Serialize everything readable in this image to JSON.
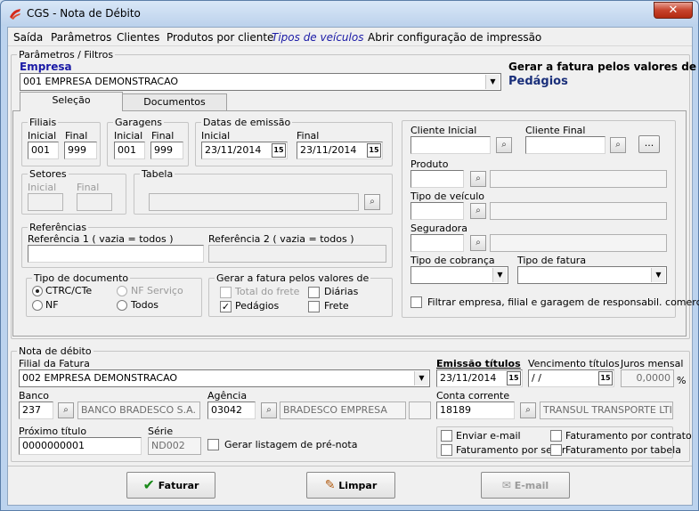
{
  "window": {
    "title": "CGS - Nota de Débito",
    "close": "✕"
  },
  "menu": [
    "Saída",
    "Parâmetros",
    "Clientes",
    "Produtos por cliente",
    "Tipos de veículos",
    "Abrir configuração de impressão"
  ],
  "filters": {
    "group_title": "Parâmetros / Filtros",
    "empresa_label": "Empresa",
    "empresa_value": "001 EMPRESA DEMONSTRACAO",
    "fatura_label": "Gerar a fatura pelos valores de",
    "fatura_value": "Pedágios",
    "tabs": [
      "Seleção",
      "Documentos"
    ],
    "filiais": {
      "title": "Filiais",
      "inicial_label": "Inicial",
      "final_label": "Final",
      "inicial": "001",
      "final": "999"
    },
    "garagens": {
      "title": "Garagens",
      "inicial_label": "Inicial",
      "final_label": "Final",
      "inicial": "001",
      "final": "999"
    },
    "datas": {
      "title": "Datas de emissão",
      "inicial_label": "Inicial",
      "final_label": "Final",
      "inicial": "23/11/2014",
      "final": "23/11/2014"
    },
    "setores": {
      "title": "Setores",
      "inicial_label": "Inicial",
      "final_label": "Final"
    },
    "tabela": {
      "title": "Tabela"
    },
    "referencias": {
      "title": "Referências",
      "ref1_label": "Referência 1 ( vazia = todos )",
      "ref2_label": "Referência 2 ( vazia = todos )"
    },
    "tipo_doc": {
      "title": "Tipo de documento",
      "ctrc": "CTRC/CTe",
      "nfservico": "NF Serviço",
      "nf": "NF",
      "todos": "Todos"
    },
    "gerar": {
      "title": "Gerar a fatura pelos valores de",
      "total_frete": "Total do frete",
      "diarias": "Diárias",
      "pedagios": "Pedágios",
      "frete": "Frete"
    },
    "cliente_inicial": "Cliente Inicial",
    "cliente_final": "Cliente Final",
    "produto": "Produto",
    "tipo_veiculo": "Tipo de veículo",
    "seguradora": "Seguradora",
    "tipo_cobranca": "Tipo de cobrança",
    "tipo_fatura": "Tipo de fatura",
    "filtrar": "Filtrar empresa, filial e garagem de responsabil. comercial"
  },
  "nota": {
    "group_title": "Nota de débito",
    "filial_label": "Filial da Fatura",
    "filial_value": "002 EMPRESA DEMONSTRACAO",
    "emissao_label": "Emissão títulos",
    "emissao_value": "23/11/2014",
    "vencimento_label": "Vencimento títulos",
    "vencimento_value": " /  /",
    "juros_label": "Juros mensal",
    "juros_value": "0,0000",
    "pct": "%",
    "banco_label": "Banco",
    "banco_code": "237",
    "banco_name": "BANCO BRADESCO S.A.",
    "agencia_label": "Agência",
    "agencia_code": "03042",
    "agencia_name": "BRADESCO EMPRESA",
    "conta_label": "Conta corrente",
    "conta_code": "18189",
    "conta_name": "TRANSUL TRANSPORTE LTI",
    "proximo_label": "Próximo título",
    "proximo_value": "0000000001",
    "serie_label": "Série",
    "serie_value": "ND002",
    "gerar_listagem": "Gerar listagem de pré-nota",
    "enviar_email": "Enviar e-mail",
    "fat_contrato": "Faturamento por contrato",
    "fat_setor": "Faturamento por setor",
    "fat_tabela": "Faturamento por tabela"
  },
  "buttons": {
    "faturar": "Faturar",
    "limpar": "Limpar",
    "email": "E-mail"
  },
  "icons": {
    "binoculars": "⌕",
    "cal": "15",
    "ellipsis": "..."
  },
  "colors": {
    "accent": "#1a1aa6"
  }
}
